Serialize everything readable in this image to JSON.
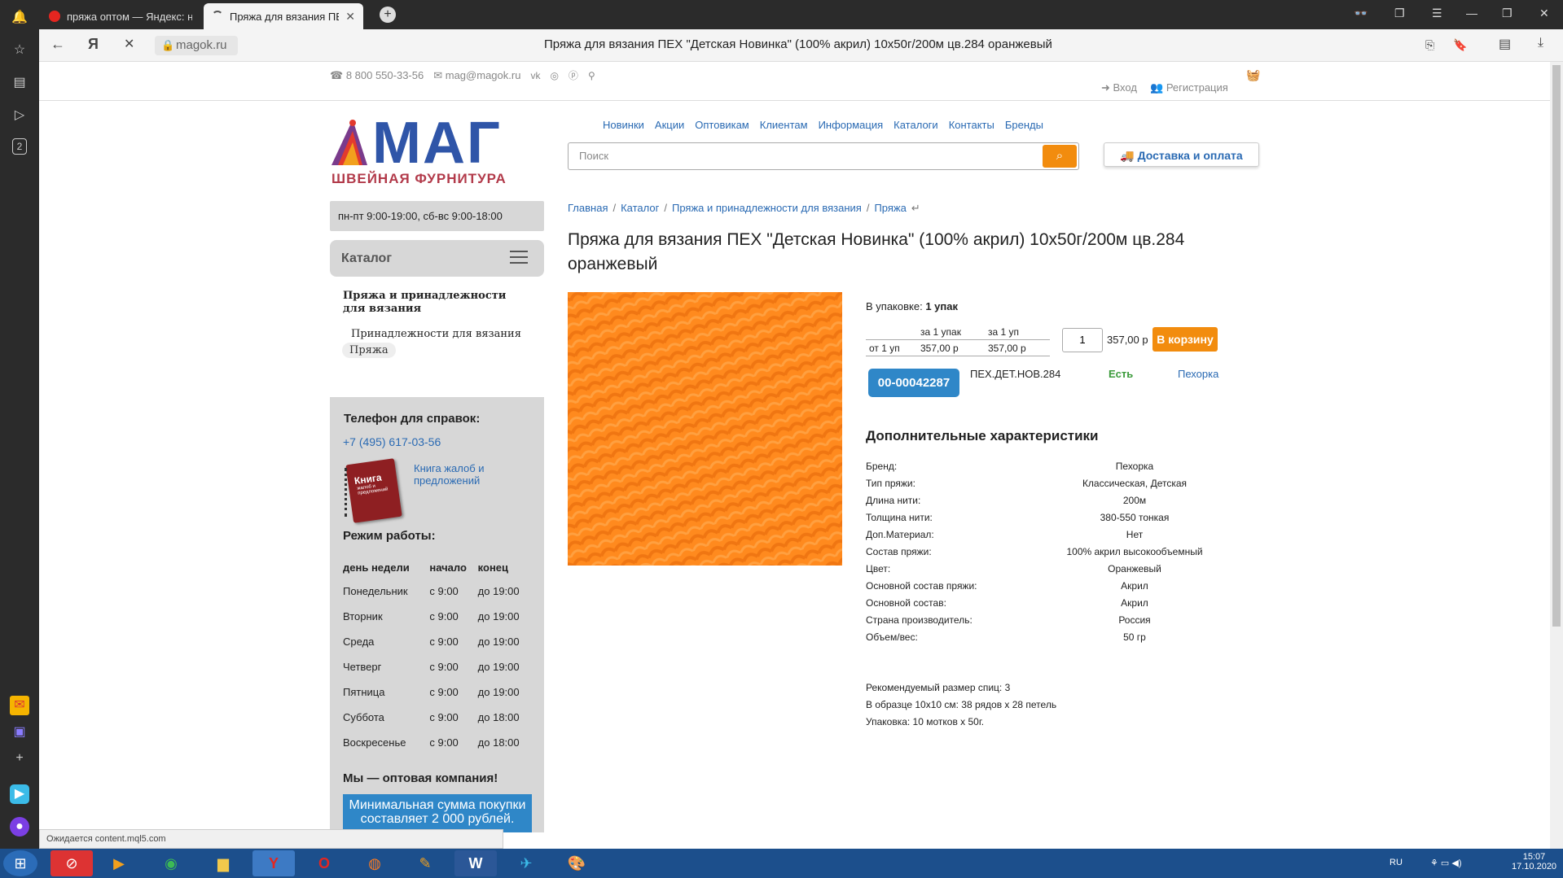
{
  "browser": {
    "tabs": [
      {
        "label": "пряжа оптом — Яндекс: н",
        "active": false
      },
      {
        "label": "Пряжа для вязания ПЕ",
        "active": true
      }
    ],
    "url": "magok.ru",
    "title": "Пряжа для вязания ПЕХ \"Детская Новинка\" (100% акрил) 10x50г/200м цв.284 оранжевый",
    "status": "Ожидается content.mql5.com"
  },
  "header": {
    "phone": "8 800 550-33-56",
    "email": "mag@magok.ru",
    "login": "Вход",
    "register": "Регистрация"
  },
  "logo": {
    "brand": "МАГ",
    "tagline": "ШВЕЙНАЯ ФУРНИТУРА"
  },
  "nav": [
    "Новинки",
    "Акции",
    "Оптовикам",
    "Клиентам",
    "Информация",
    "Каталоги",
    "Контакты",
    "Бренды"
  ],
  "search": {
    "placeholder": "Поиск"
  },
  "delivery_label": "Доставка и оплата",
  "sidebar": {
    "hours": "пн-пт 9:00-19:00, сб-вс 9:00-18:00",
    "catalog": "Каталог",
    "cat_title": "Пряжа и принадлежности для вязания",
    "cat_items": [
      "Принадлежности для вязания",
      "Пряжа"
    ],
    "phone_heading": "Телефон для справок:",
    "phone": "+7 (495) 617-03-56",
    "book_link": "Книга жалоб и предложений",
    "book_cover": [
      "Книга",
      "жалоб и",
      "предложений"
    ],
    "work_heading": "Режим работы:",
    "work_headers": [
      "день недели",
      "начало",
      "конец"
    ],
    "work_rows": [
      [
        "Понедельник",
        "с 9:00",
        "до 19:00"
      ],
      [
        "Вторник",
        "с 9:00",
        "до 19:00"
      ],
      [
        "Среда",
        "с 9:00",
        "до 19:00"
      ],
      [
        "Четверг",
        "с 9:00",
        "до 19:00"
      ],
      [
        "Пятница",
        "с 9:00",
        "до 19:00"
      ],
      [
        "Суббота",
        "с 9:00",
        "до 18:00"
      ],
      [
        "Воскресенье",
        "с 9:00",
        "до 18:00"
      ]
    ],
    "wholesale": "Мы — оптовая компания!",
    "min_order": "Минимальная сумма покупки составляет 2 000 рублей."
  },
  "breadcrumb": [
    "Главная",
    "Каталог",
    "Пряжа и принадлежности для вязания",
    "Пряжа"
  ],
  "product": {
    "title": "Пряжа для вязания ПЕХ \"Детская Новинка\" (100% акрил) 10x50г/200м цв.284 оранжевый",
    "pack_label": "В упаковке:",
    "pack_value": "1 упак",
    "price_head": [
      "",
      "за 1 упак",
      "за 1 уп"
    ],
    "price_row": [
      "от 1 уп",
      "357,00 р",
      "357,00 р"
    ],
    "qty": "1",
    "total": "357,00 р",
    "cart": "В корзину",
    "sku": "00-00042287",
    "code": "ПЕХ.ДЕТ.НОВ.284",
    "stock": "Есть",
    "brand_link": "Пехорка",
    "image_color": "#ff8a1e"
  },
  "chars_heading": "Дополнительные характеристики",
  "chars": [
    [
      "Бренд:",
      "Пехорка"
    ],
    [
      "Тип пряжи:",
      "Классическая, Детская"
    ],
    [
      "Длина нити:",
      "200м"
    ],
    [
      "Толщина нити:",
      "380-550 тонкая"
    ],
    [
      "Доп.Материал:",
      "Нет"
    ],
    [
      "Состав пряжи:",
      "100% акрил высокообъемный"
    ],
    [
      "Цвет:",
      "Оранжевый"
    ],
    [
      "Основной состав пряжи:",
      "Акрил"
    ],
    [
      "Основной состав:",
      "Акрил"
    ],
    [
      "Страна производитель:",
      "Россия"
    ],
    [
      "Объем/вес:",
      "50 гр"
    ]
  ],
  "description": [
    "Рекомендуемый размер спиц: 3",
    "В образце 10x10 см: 38 рядов х 28 петель",
    "Упаковка: 10 мотков х 50г."
  ],
  "taskbar": {
    "lang": "RU",
    "time": "15:07",
    "date": "17.10.2020"
  }
}
